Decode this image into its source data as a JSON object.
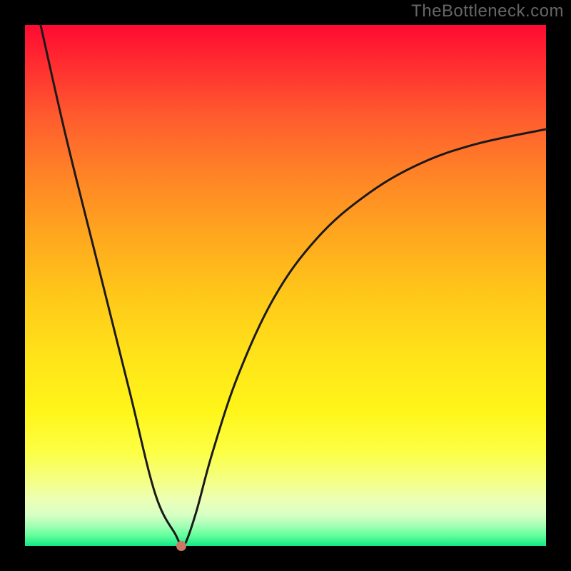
{
  "watermark": "TheBottleneck.com",
  "chart_data": {
    "type": "line",
    "title": "",
    "xlabel": "",
    "ylabel": "",
    "xlim": [
      0,
      100
    ],
    "ylim": [
      0,
      100
    ],
    "series": [
      {
        "name": "bottleneck-curve",
        "x": [
          3,
          8,
          14,
          20,
          25,
          29,
          30,
          31,
          33,
          36,
          41,
          48,
          56,
          65,
          75,
          86,
          100
        ],
        "y": [
          100,
          78,
          54,
          30,
          10,
          2,
          0,
          1,
          7,
          18,
          33,
          48,
          59,
          67,
          73,
          77,
          80
        ]
      }
    ],
    "annotations": [
      {
        "name": "min-point",
        "x": 30,
        "y": 0
      }
    ],
    "grid": false,
    "legend": false
  },
  "colors": {
    "curve": "#1a1a1a",
    "dot": "#cc7766",
    "background_top": "#ff0a32",
    "background_bottom": "#12e785",
    "frame": "#000000",
    "watermark": "#666666"
  }
}
